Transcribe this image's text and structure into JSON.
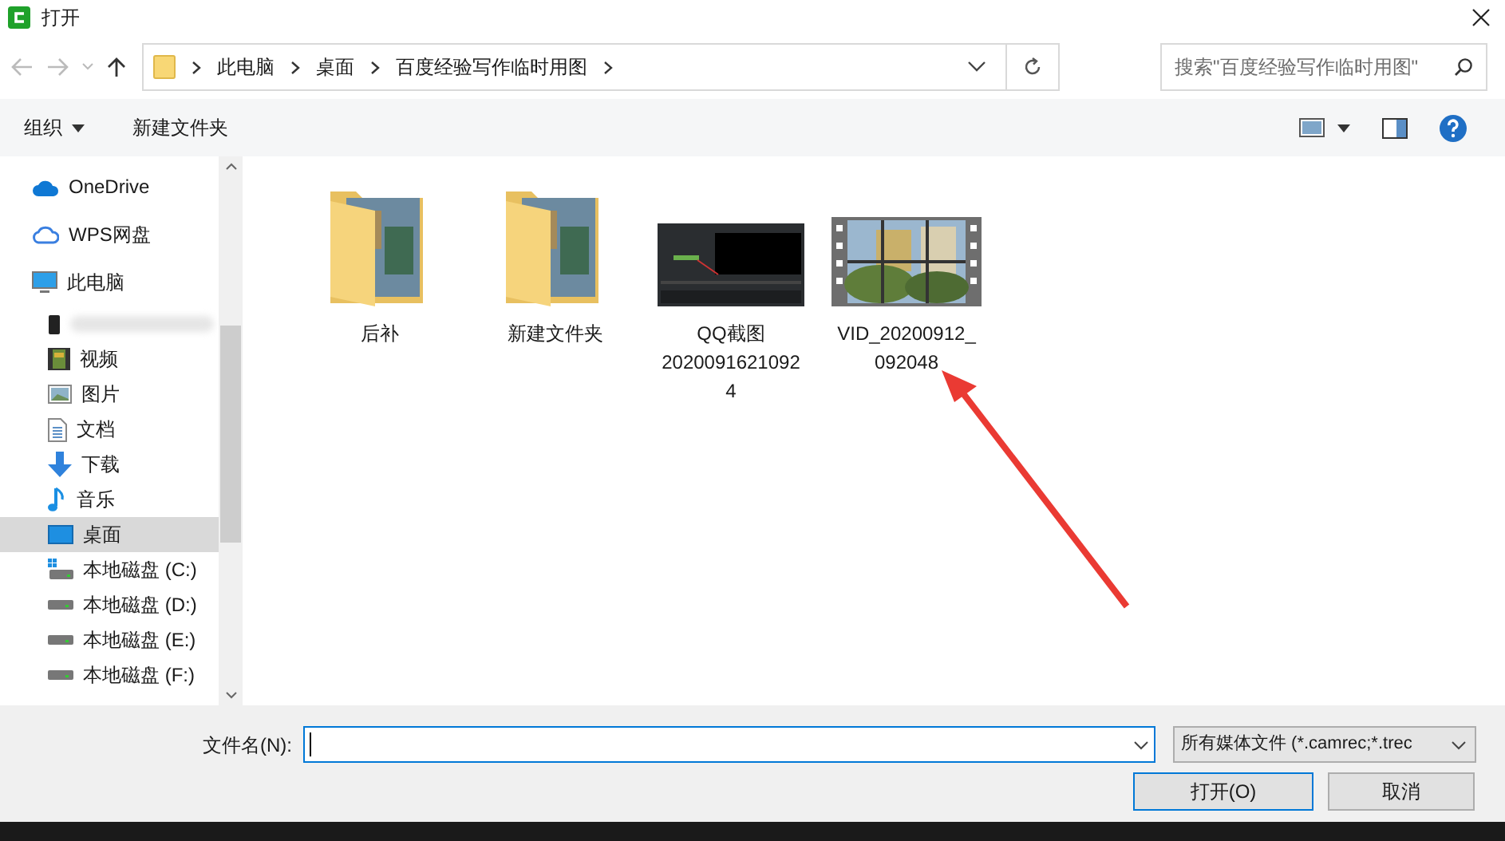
{
  "window": {
    "title": "打开"
  },
  "nav": {
    "breadcrumbs": [
      "此电脑",
      "桌面",
      "百度经验写作临时用图"
    ],
    "search": {
      "placeholder": "搜索\"百度经验写作临时用图\""
    }
  },
  "toolbar": {
    "organize": "组织",
    "new_folder": "新建文件夹"
  },
  "sidebar": {
    "items": [
      {
        "label": "OneDrive",
        "kind": "cloud",
        "selected": false
      },
      {
        "label": "WPS网盘",
        "kind": "cloud-outline",
        "selected": false
      },
      {
        "label": "此电脑",
        "kind": "pc",
        "selected": false,
        "children": [
          {
            "kind": "redacted",
            "selected": false
          },
          {
            "label": "视频",
            "kind": "video",
            "selected": false
          },
          {
            "label": "图片",
            "kind": "pictures",
            "selected": false
          },
          {
            "label": "文档",
            "kind": "docs",
            "selected": false
          },
          {
            "label": "下载",
            "kind": "download",
            "selected": false
          },
          {
            "label": "音乐",
            "kind": "music",
            "selected": false
          },
          {
            "label": "桌面",
            "kind": "desktop",
            "selected": true
          },
          {
            "label": "本地磁盘 (C:)",
            "kind": "system-drive",
            "selected": false
          },
          {
            "label": "本地磁盘 (D:)",
            "kind": "drive",
            "selected": false
          },
          {
            "label": "本地磁盘 (E:)",
            "kind": "drive",
            "selected": false
          },
          {
            "label": "本地磁盘 (F:)",
            "kind": "drive",
            "selected": false
          }
        ]
      }
    ]
  },
  "files": [
    {
      "name": "后补",
      "kind": "folder"
    },
    {
      "name": "新建文件夹",
      "kind": "folder"
    },
    {
      "name": "QQ截图20200916210924",
      "kind": "screenshot"
    },
    {
      "name": "VID_20200912_092048",
      "kind": "video"
    }
  ],
  "bottom": {
    "filename_label": "文件名(N):",
    "filetype": "所有媒体文件 (*.camrec;*.trec",
    "open": "打开(O)",
    "cancel": "取消"
  }
}
